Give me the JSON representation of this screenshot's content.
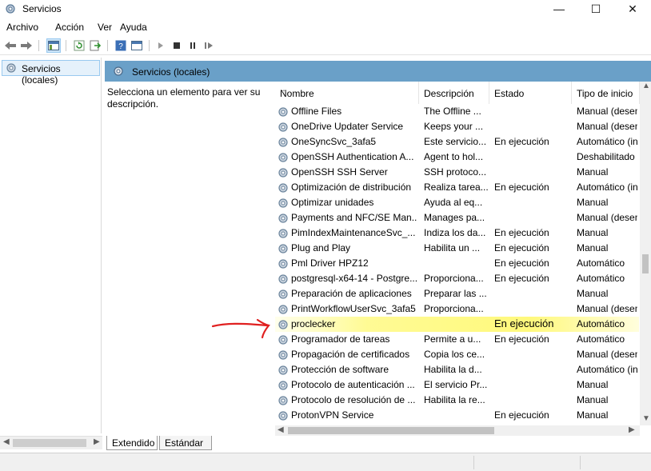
{
  "window": {
    "title": "Servicios",
    "minimize": "—",
    "maximize": "☐",
    "close": "✕"
  },
  "menu": {
    "items": [
      "Archivo",
      "Acción",
      "Ver",
      "Ayuda"
    ]
  },
  "tree": {
    "selected": "Servicios (locales)"
  },
  "main": {
    "header": "Servicios (locales)",
    "description": "Selecciona un elemento para ver su descripción."
  },
  "columns": {
    "name": "Nombre",
    "description": "Descripción",
    "status": "Estado",
    "startup": "Tipo de inicio"
  },
  "services": [
    {
      "name": "Offline Files",
      "description": "The Offline ...",
      "status": "",
      "startup": "Manual (desencadenar inicio)"
    },
    {
      "name": "OneDrive Updater Service",
      "description": "Keeps your ...",
      "status": "",
      "startup": "Manual (desencadenar inicio)"
    },
    {
      "name": "OneSyncSvc_3afa5",
      "description": "Este servicio...",
      "status": "En ejecución",
      "startup": "Automático (inicio retrasado)"
    },
    {
      "name": "OpenSSH Authentication A...",
      "description": "Agent to hol...",
      "status": "",
      "startup": "Deshabilitado"
    },
    {
      "name": "OpenSSH SSH Server",
      "description": "SSH protoco...",
      "status": "",
      "startup": "Manual"
    },
    {
      "name": "Optimización de distribución",
      "description": "Realiza tarea...",
      "status": "En ejecución",
      "startup": "Automático (inicio retrasado)"
    },
    {
      "name": "Optimizar unidades",
      "description": "Ayuda al eq...",
      "status": "",
      "startup": "Manual"
    },
    {
      "name": "Payments and NFC/SE Man...",
      "description": "Manages pa...",
      "status": "",
      "startup": "Manual (desencadenar inicio)"
    },
    {
      "name": "PimIndexMaintenanceSvc_...",
      "description": "Indiza los da...",
      "status": "En ejecución",
      "startup": "Manual"
    },
    {
      "name": "Plug and Play",
      "description": "Habilita un ...",
      "status": "En ejecución",
      "startup": "Manual"
    },
    {
      "name": "Pml Driver HPZ12",
      "description": "",
      "status": "En ejecución",
      "startup": "Automático"
    },
    {
      "name": "postgresql-x64-14 - Postgre...",
      "description": "Proporciona...",
      "status": "En ejecución",
      "startup": "Automático"
    },
    {
      "name": "Preparación de aplicaciones",
      "description": "Preparar las ...",
      "status": "",
      "startup": "Manual"
    },
    {
      "name": "PrintWorkflowUserSvc_3afa5",
      "description": "Proporciona...",
      "status": "",
      "startup": "Manual (desencadenar inicio)"
    },
    {
      "name": "proclecker",
      "description": "",
      "status": "En ejecución",
      "startup": "Automático"
    },
    {
      "name": "Programador de tareas",
      "description": "Permite a u...",
      "status": "En ejecución",
      "startup": "Automático"
    },
    {
      "name": "Propagación de certificados",
      "description": "Copia los ce...",
      "status": "",
      "startup": "Manual (desencadenar inicio)"
    },
    {
      "name": "Protección de software",
      "description": "Habilita la d...",
      "status": "",
      "startup": "Automático (inicio retrasado)"
    },
    {
      "name": "Protocolo de autenticación ...",
      "description": "El servicio Pr...",
      "status": "",
      "startup": "Manual"
    },
    {
      "name": "Protocolo de resolución de ...",
      "description": "Habilita la re...",
      "status": "",
      "startup": "Manual"
    },
    {
      "name": "ProtonVPN Service",
      "description": "",
      "status": "En ejecución",
      "startup": "Manual"
    }
  ],
  "tabs": [
    "Extendido",
    "Estándar"
  ],
  "colors": {
    "header_bg": "#6aa0c8",
    "highlight": "#fff86e",
    "annotation": "#e02020",
    "selection_bg": "#e5f1fb"
  }
}
